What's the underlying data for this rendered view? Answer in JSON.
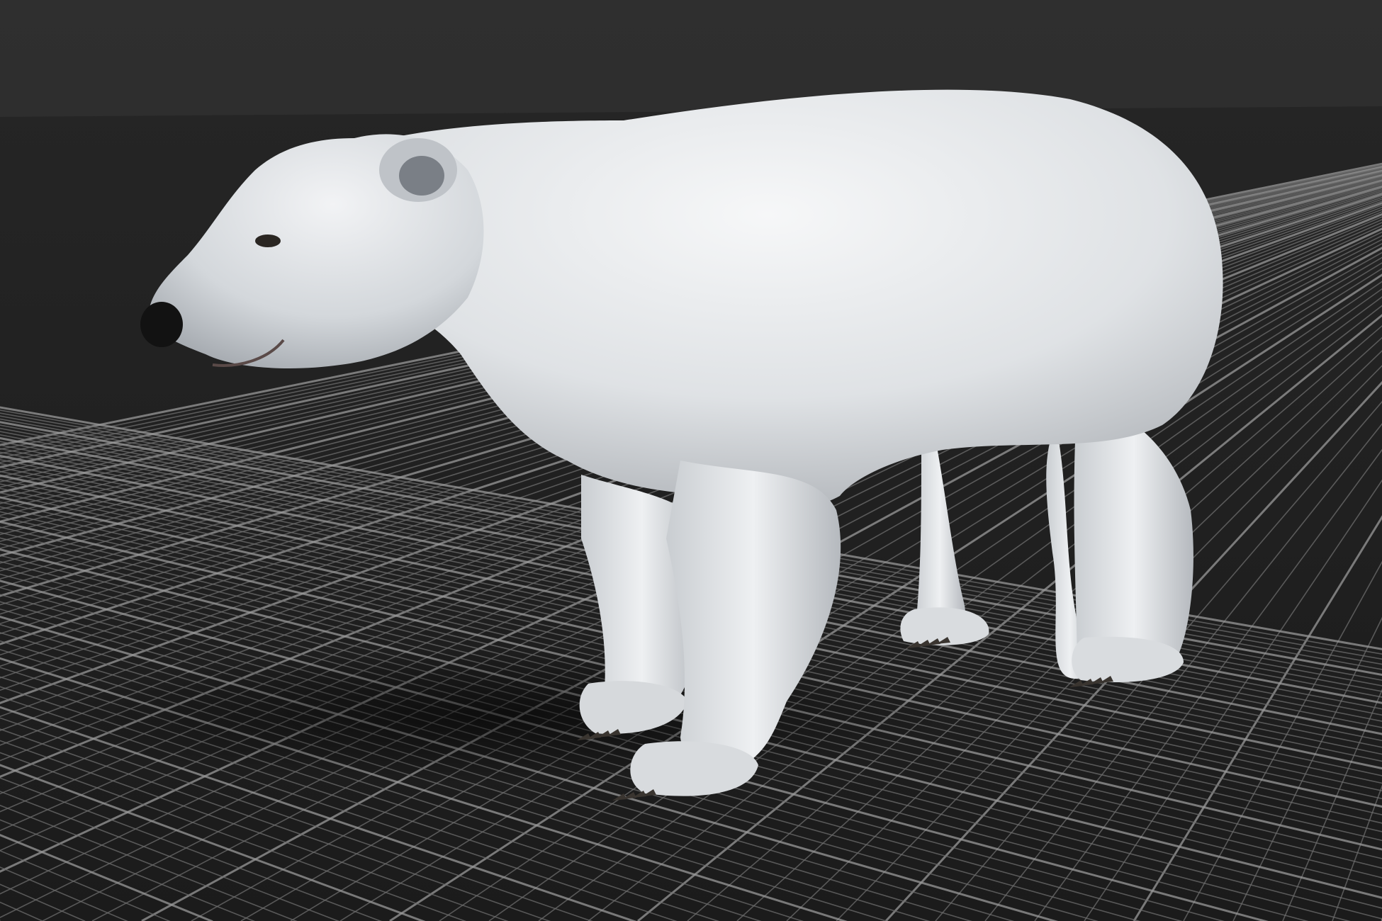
{
  "viewport": {
    "background_color": "#2b2b2b",
    "floor_color": "#1a1a1a",
    "grid_line_color": "#6e6e6e",
    "grid_major_color": "#9a9a9a",
    "grid_visible": true
  },
  "model": {
    "subject": "polar bear",
    "fur_color": "#e8eaec",
    "shadow_color": "#9ca0a6",
    "claw_color": "#3a3530",
    "nose_color": "#121212"
  }
}
